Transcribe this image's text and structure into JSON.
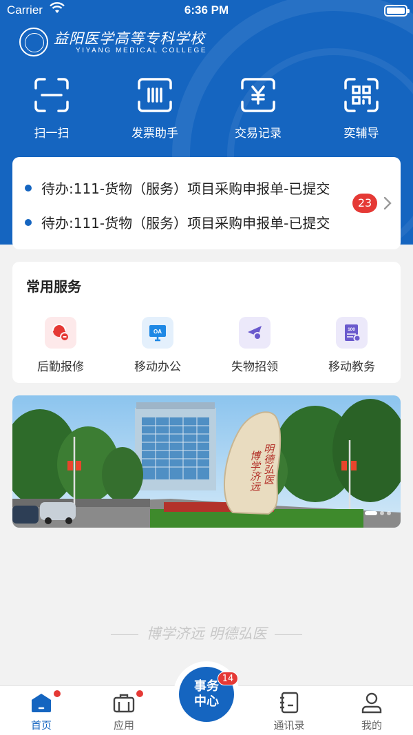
{
  "status_bar": {
    "carrier": "Carrier",
    "time": "6:36 PM"
  },
  "header": {
    "logo_cn": "益阳医学高等专科学校",
    "logo_en": "YIYANG MEDICAL COLLEGE"
  },
  "quick_actions": [
    {
      "label": "扫一扫",
      "icon": "scan-icon"
    },
    {
      "label": "发票助手",
      "icon": "invoice-icon"
    },
    {
      "label": "交易记录",
      "icon": "yuan-transaction-icon"
    },
    {
      "label": "奕辅导",
      "icon": "qr-code-icon"
    }
  ],
  "todo": {
    "items": [
      "待办:111-货物（服务）项目采购申报单-已提交",
      "待办:111-货物（服务）项目采购申报单-已提交"
    ],
    "count": "23"
  },
  "services": {
    "title": "常用服务",
    "items": [
      {
        "label": "后勤报修",
        "icon": "repair-icon",
        "color": "#e53935"
      },
      {
        "label": "移动办公",
        "icon": "oa-icon",
        "color": "#1e88e5"
      },
      {
        "label": "失物招领",
        "icon": "lost-found-icon",
        "color": "#6a5acd"
      },
      {
        "label": "移动教务",
        "icon": "academic-icon",
        "color": "#6a5acd"
      }
    ]
  },
  "banner": {
    "stone_text": "明德弘医 博学济远"
  },
  "motto": "博学济远  明德弘医",
  "tabbar": {
    "tabs": [
      {
        "label": "首页",
        "icon": "home-icon"
      },
      {
        "label": "应用",
        "icon": "briefcase-icon"
      },
      {
        "label": "通讯录",
        "icon": "contacts-icon"
      },
      {
        "label": "我的",
        "icon": "profile-icon"
      }
    ],
    "center_line1": "事务",
    "center_line2": "中心",
    "center_badge": "14"
  },
  "colors": {
    "primary": "#1565c0",
    "badge": "#e53935",
    "background": "#f2f2f2"
  }
}
